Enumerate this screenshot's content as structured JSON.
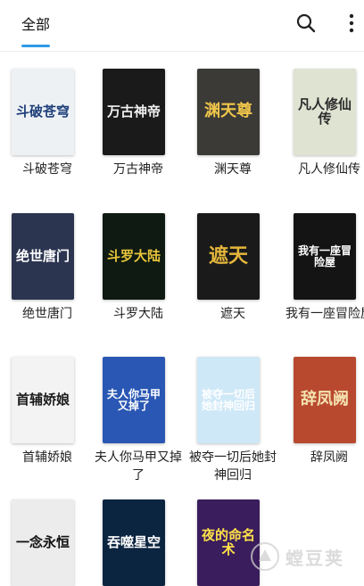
{
  "header": {
    "tab_label": "全部",
    "accent_color": "#2f9be8"
  },
  "books": [
    {
      "title": "斗破苍穹",
      "cover_text": "斗破苍穹",
      "cover_bg": "#eef1f4",
      "cover_fg": "#1d3f7a"
    },
    {
      "title": "万古神帝",
      "cover_text": "万古神帝",
      "cover_bg": "#1a1a1a",
      "cover_fg": "#f0f0f0"
    },
    {
      "title": "渊天尊",
      "cover_text": "渊天尊",
      "cover_bg": "#3b3a36",
      "cover_fg": "#f1c64b"
    },
    {
      "title": "凡人修仙传",
      "cover_text": "凡人修仙传",
      "cover_bg": "#dfe3d2",
      "cover_fg": "#2b2b2b"
    },
    {
      "title": "绝世唐门",
      "cover_text": "绝世唐门",
      "cover_bg": "#2c3550",
      "cover_fg": "#ffffff"
    },
    {
      "title": "斗罗大陆",
      "cover_text": "斗罗大陆",
      "cover_bg": "#0e1a12",
      "cover_fg": "#e8c43a"
    },
    {
      "title": "遮天",
      "cover_text": "遮天",
      "cover_bg": "#1a1a1a",
      "cover_fg": "#e3b53a"
    },
    {
      "title": "我有一座冒险屋",
      "cover_text": "我有一座冒险屋",
      "cover_bg": "#141414",
      "cover_fg": "#ffffff"
    },
    {
      "title": "首辅娇娘",
      "cover_text": "首辅娇娘",
      "cover_bg": "#f3f3f3",
      "cover_fg": "#1b1b1b"
    },
    {
      "title": "夫人你马甲又掉了",
      "cover_text": "夫人你马甲又掉了",
      "cover_bg": "#2a57b4",
      "cover_fg": "#ffffff"
    },
    {
      "title": "被夺一切后她封神回归",
      "cover_text": "被夺一切后她封神回归",
      "cover_bg": "#cfe8f7",
      "cover_fg": "#ffffff"
    },
    {
      "title": "辞凤阙",
      "cover_text": "辞凤阙",
      "cover_bg": "#b8492f",
      "cover_fg": "#f4e3b0"
    },
    {
      "title": "",
      "cover_text": "一念永恒",
      "cover_bg": "#ececec",
      "cover_fg": "#111111"
    },
    {
      "title": "",
      "cover_text": "吞噬星空",
      "cover_bg": "#0b2440",
      "cover_fg": "#ffffff"
    },
    {
      "title": "",
      "cover_text": "夜的命名术",
      "cover_bg": "#3a1d5c",
      "cover_fg": "#ffe14a"
    }
  ],
  "watermark": {
    "text": "螳豆荚"
  }
}
